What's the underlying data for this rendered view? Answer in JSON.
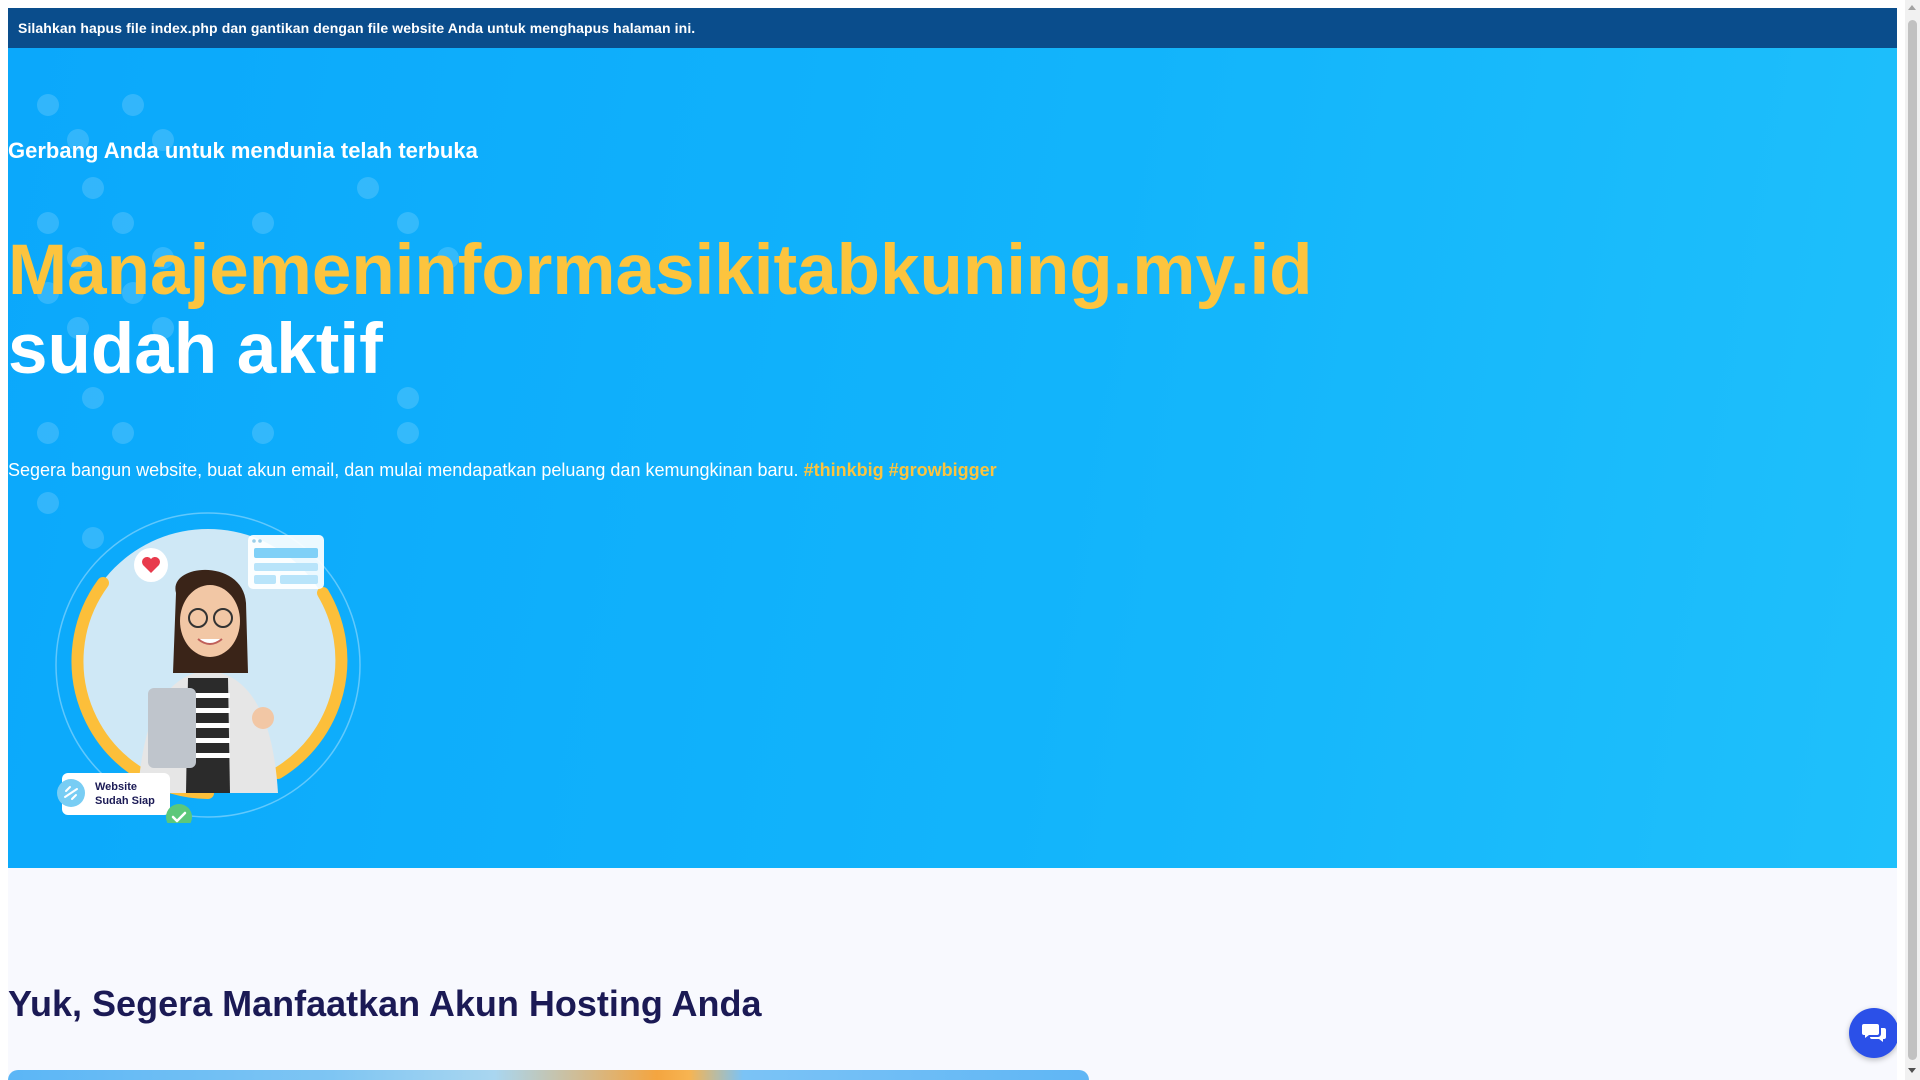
{
  "notice": {
    "text": "Silahkan hapus file index.php dan gantikan dengan file website Anda untuk menghapus halaman ini."
  },
  "hero": {
    "tagline": "Gerbang Anda untuk mendunia telah terbuka",
    "domain": "Manajemeninformasikitabkuning.my.id",
    "status": "sudah aktif",
    "description": "Segera bangun website, buat akun email, dan mulai mendapatkan peluang dan kemungkinan baru.",
    "hashtags": "#thinkbig #growbigger",
    "illustration": {
      "badge_line1": "Website",
      "badge_line2": "Sudah Siap",
      "icons": [
        "heart-icon",
        "browser-window-icon",
        "link-icon",
        "check-icon"
      ]
    }
  },
  "section": {
    "title": "Yuk, Segera Manfaatkan Akun Hosting Anda"
  },
  "chat": {
    "icon": "chat-bubbles-icon"
  },
  "colors": {
    "notice_bg": "#0a4d8c",
    "hero_bg": "#12b4fb",
    "accent_yellow": "#fcc43e",
    "section_title": "#1b1a55",
    "chat_button": "#2b50e8"
  }
}
